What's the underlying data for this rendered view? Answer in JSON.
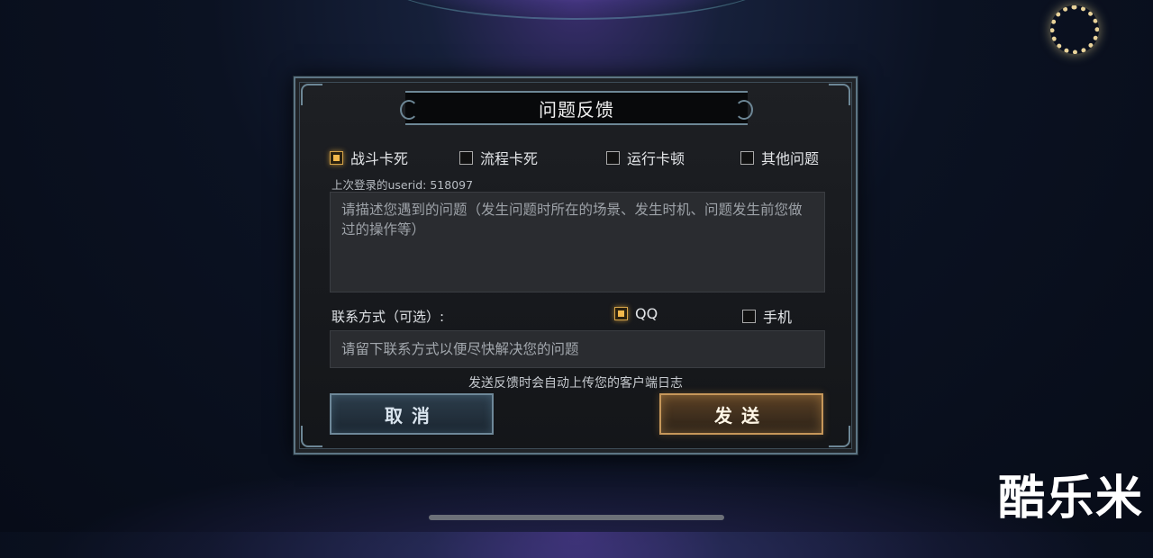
{
  "dialog": {
    "title": "问题反馈",
    "issue_types": [
      {
        "label": "战斗卡死",
        "checked": true
      },
      {
        "label": "流程卡死",
        "checked": false
      },
      {
        "label": "运行卡顿",
        "checked": false
      },
      {
        "label": "其他问题",
        "checked": false
      }
    ],
    "userid_text": "上次登录的userid: 518097",
    "description_placeholder": "请描述您遇到的问题（发生问题时所在的场景、发生时机、问题发生前您做过的操作等）",
    "contact_label": "联系方式（可选）:",
    "contact_options": [
      {
        "label": "QQ",
        "checked": true
      },
      {
        "label": "手机",
        "checked": false
      }
    ],
    "contact_placeholder": "请留下联系方式以便尽快解决您的问题",
    "notice": "发送反馈时会自动上传您的客户端日志",
    "cancel_label": "取消",
    "send_label": "发送"
  },
  "watermark": "酷乐米",
  "colors": {
    "accent_checked": "#f2b84c",
    "frame": "#5d7584",
    "send_border": "#c6975a"
  }
}
